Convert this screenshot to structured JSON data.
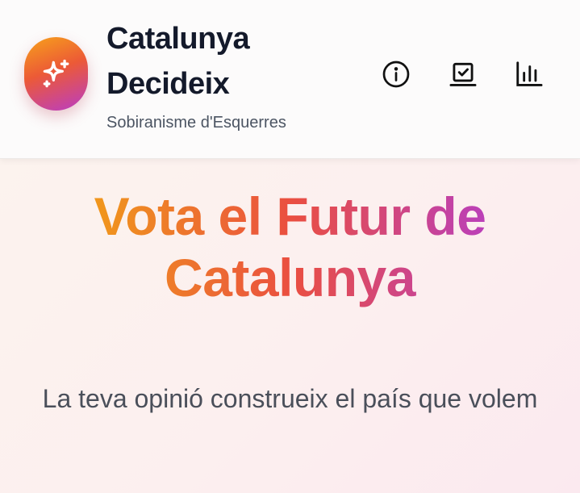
{
  "header": {
    "logo_icon": "sparkles-icon",
    "title_line1": "Catalunya",
    "title_line2": "Decideix",
    "subtitle": "Sobiranisme d'Esquerres",
    "nav": [
      {
        "icon": "info-icon"
      },
      {
        "icon": "vote-icon"
      },
      {
        "icon": "bar-chart-icon"
      }
    ]
  },
  "hero": {
    "title_words": [
      "Vota",
      "el",
      "Futur",
      "de",
      "Catalunya"
    ],
    "subtitle": "La teva opinió construeix el país que volem"
  },
  "colors": {
    "gradient_start": "#f0961c",
    "gradient_mid": "#ea4f40",
    "gradient_end": "#bb3fb8",
    "text_dark": "#141a2b",
    "text_muted": "#4c5563"
  }
}
